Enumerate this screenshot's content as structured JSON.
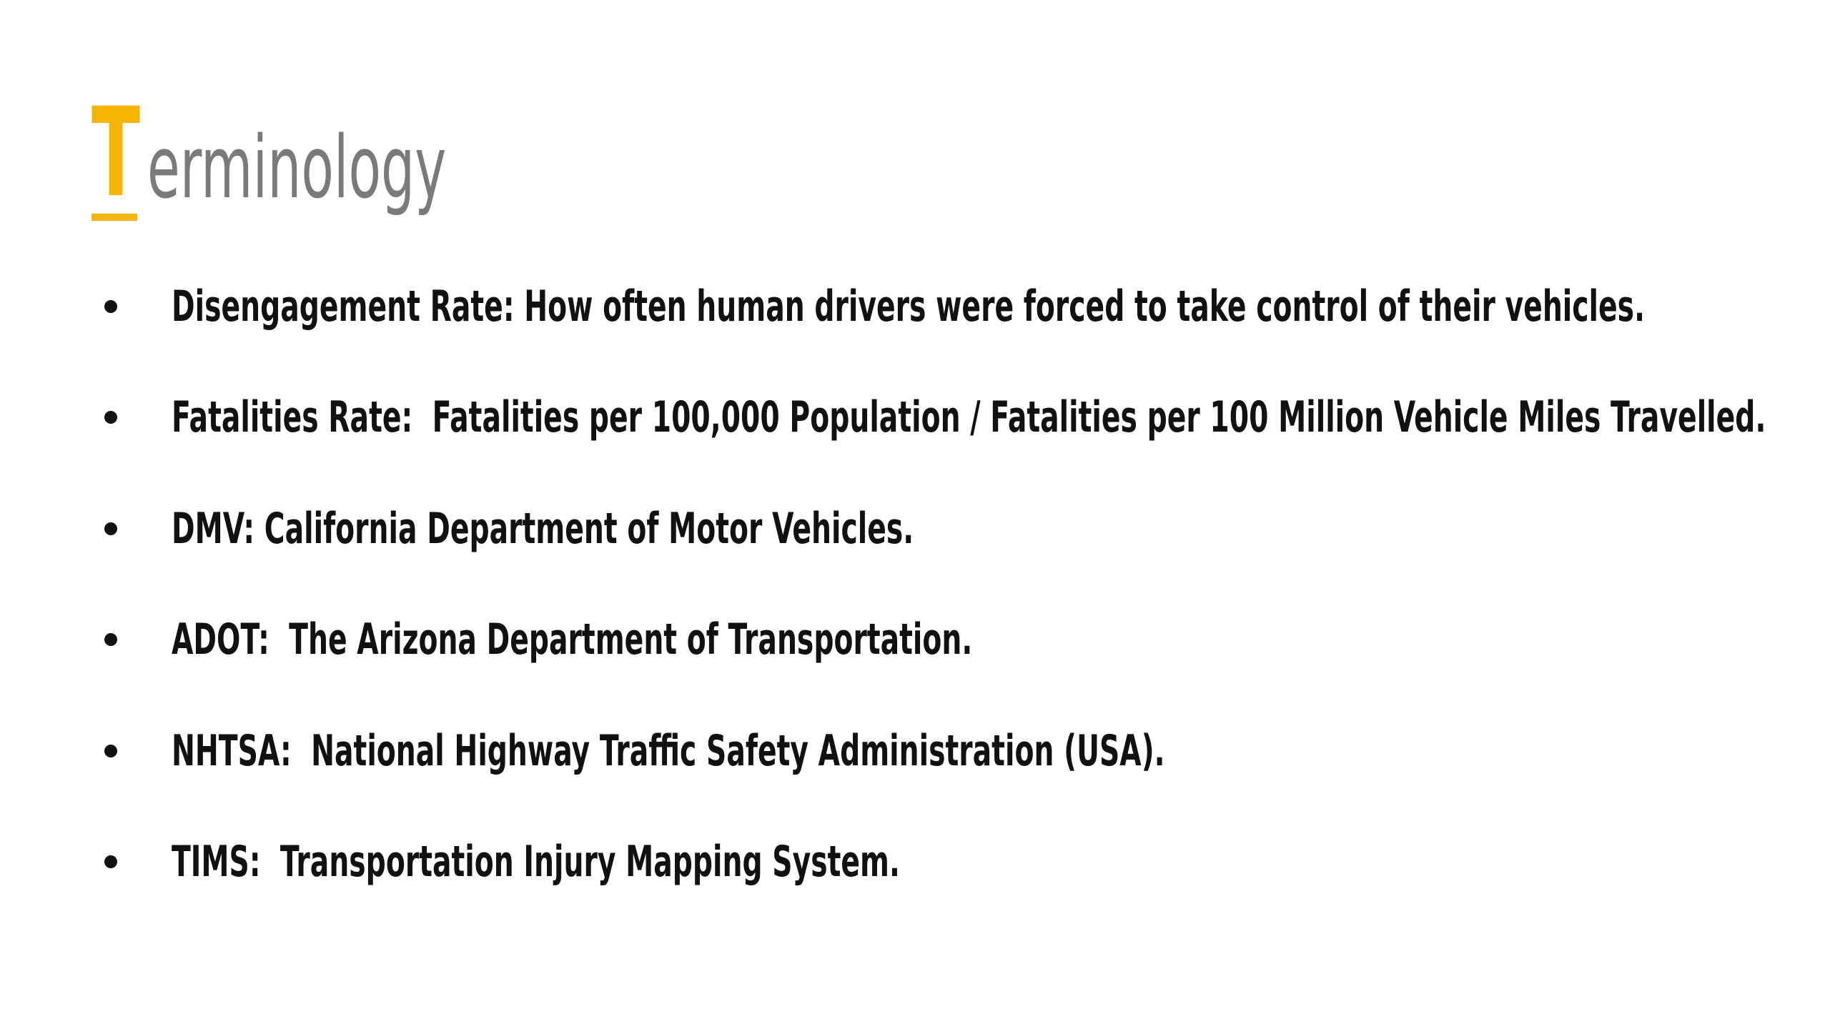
{
  "slide": {
    "title_initial": "T",
    "title_rest": "erminology",
    "accent_color": "#f5b400",
    "title_color": "#7a7a7a",
    "text_color": "#111111",
    "items": [
      {
        "text": "Disengagement Rate: How often human drivers were forced to take control of their vehicles."
      },
      {
        "text": "Fatalities Rate:  Fatalities per 100,000 Population / Fatalities per 100 Million Vehicle Miles Travelled."
      },
      {
        "text": "DMV: California Department of Motor Vehicles."
      },
      {
        "text": "ADOT:  The Arizona Department of Transportation."
      },
      {
        "text": "NHTSA:  National Highway Traffic Safety Administration (USA)."
      },
      {
        "text": "TIMS:  Transportation Injury Mapping System."
      }
    ]
  }
}
